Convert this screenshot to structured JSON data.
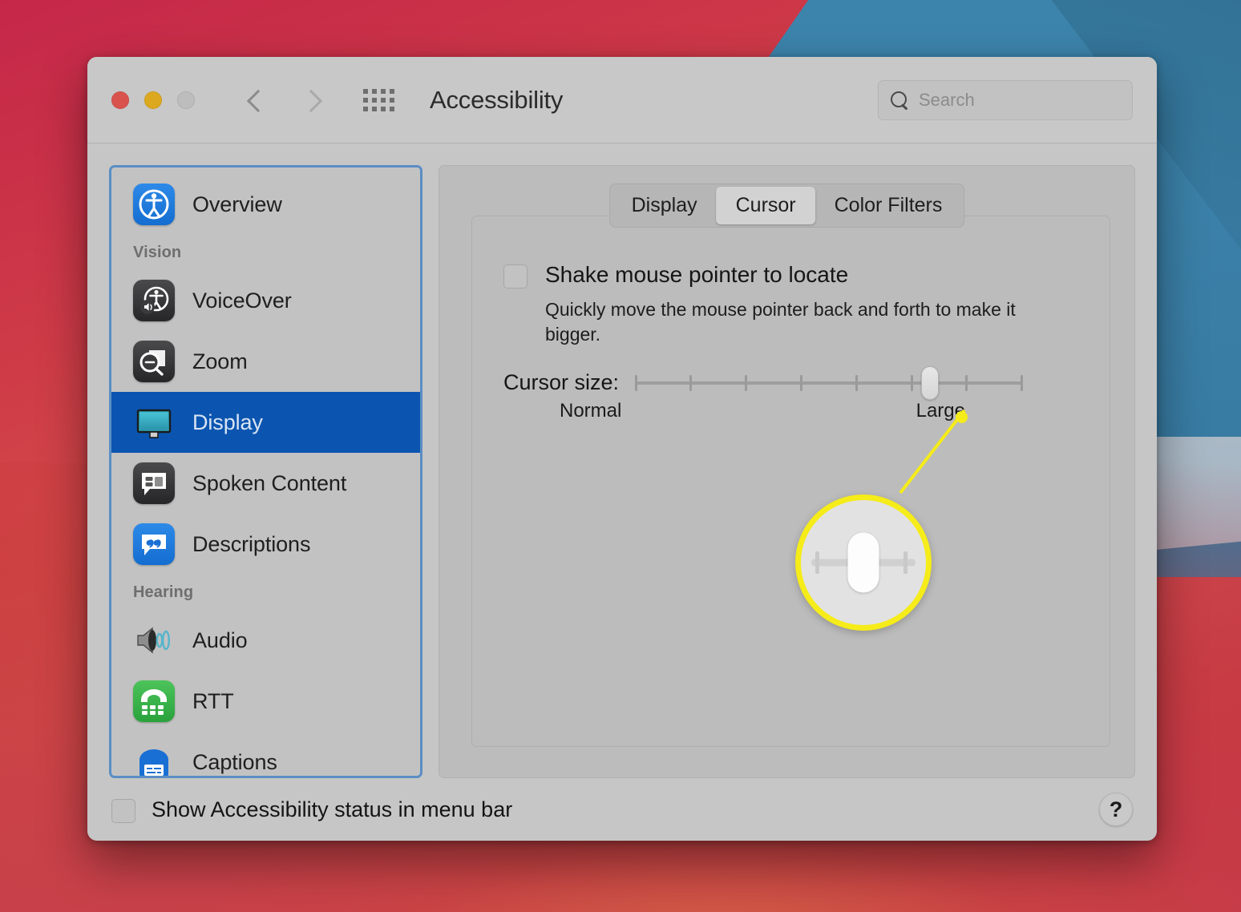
{
  "window": {
    "title": "Accessibility",
    "traffic_lights": [
      "close-red",
      "minimize-yellow",
      "zoom-grey-disabled"
    ],
    "nav": {
      "back": "back-chevron",
      "forward": "forward-chevron",
      "grid": "show-all-grid"
    },
    "search": {
      "placeholder": "Search",
      "value": "",
      "icon": "search-icon"
    }
  },
  "sidebar": {
    "items": [
      {
        "label": "Overview",
        "icon": "accessibility-person-icon",
        "type": "item",
        "selected": false,
        "icon_style": "blue"
      },
      {
        "label": "Vision",
        "icon": "",
        "type": "header",
        "selected": false,
        "icon_style": "none"
      },
      {
        "label": "VoiceOver",
        "icon": "voiceover-speaker-icon",
        "type": "item",
        "selected": false,
        "icon_style": "dark"
      },
      {
        "label": "Zoom",
        "icon": "zoom-magnifier-icon",
        "type": "item",
        "selected": false,
        "icon_style": "dark"
      },
      {
        "label": "Display",
        "icon": "display-monitor-icon",
        "type": "item",
        "selected": true,
        "icon_style": "none"
      },
      {
        "label": "Spoken Content",
        "icon": "speech-bubble-icon",
        "type": "item",
        "selected": false,
        "icon_style": "dark"
      },
      {
        "label": "Descriptions",
        "icon": "quote-bubble-icon",
        "type": "item",
        "selected": false,
        "icon_style": "blue"
      },
      {
        "label": "Hearing",
        "icon": "",
        "type": "header",
        "selected": false,
        "icon_style": "none"
      },
      {
        "label": "Audio",
        "icon": "audio-speaker-icon",
        "type": "item",
        "selected": false,
        "icon_style": "none"
      },
      {
        "label": "RTT",
        "icon": "rtt-telephone-icon",
        "type": "item",
        "selected": false,
        "icon_style": "green"
      },
      {
        "label": "Captions",
        "icon": "captions-icon",
        "type": "item",
        "selected": false,
        "icon_style": "none"
      }
    ]
  },
  "main": {
    "tabs": [
      {
        "label": "Display",
        "active": false
      },
      {
        "label": "Cursor",
        "active": true
      },
      {
        "label": "Color Filters",
        "active": false
      }
    ],
    "shake": {
      "label": "Shake mouse pointer to locate",
      "checked": false,
      "description": "Quickly move the mouse pointer back and forth to make it bigger."
    },
    "cursor_size": {
      "caption": "Cursor size:",
      "min_label": "Normal",
      "max_label": "Large",
      "ticks": 8,
      "value_index": 6,
      "value_percent": 76
    },
    "callout": {
      "highlight_color": "#f5ec19",
      "target": "slider-thumb"
    }
  },
  "footer": {
    "menu_bar_checkbox": {
      "label": "Show Accessibility status in menu bar",
      "checked": false
    },
    "help_label": "?"
  },
  "colors": {
    "accent_selected": "#0b55b0",
    "sidebar_focus_ring": "#5a8ec4",
    "highlight_yellow": "#f5ec19",
    "window_bg": "#c6c6c6"
  }
}
